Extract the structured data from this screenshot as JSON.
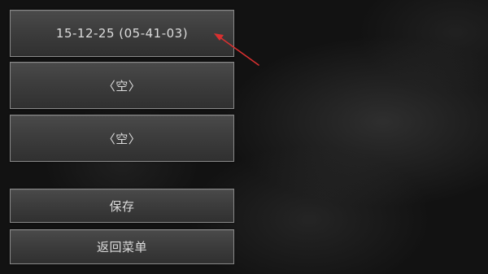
{
  "save_slots": [
    {
      "label": "15-12-25 (05-41-03)"
    },
    {
      "label": "〈空〉"
    },
    {
      "label": "〈空〉"
    }
  ],
  "actions": {
    "save_label": "保存",
    "return_menu_label": "返回菜单"
  },
  "annotation": {
    "arrow_color": "#d93030"
  }
}
